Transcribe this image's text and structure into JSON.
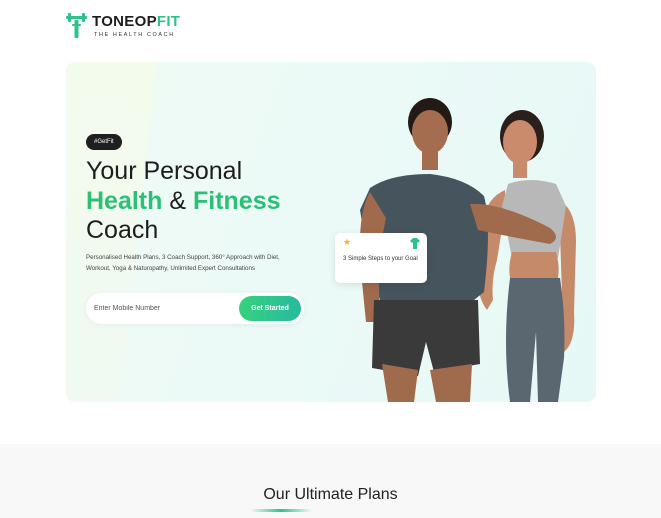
{
  "header": {
    "brand_main": "TONEOP",
    "brand_accent": "FIT",
    "tagline": "THE HEALTH COACH"
  },
  "hero": {
    "badge": "#GetFit",
    "headline_line1": "Your Personal",
    "headline_accent1": "Health",
    "headline_joiner": " & ",
    "headline_accent2": "Fitness",
    "headline_line3": "Coach",
    "description": "Personalised Health Plans, 3 Coach Support, 360° Approach with Diet, Workout, Yoga & Naturopathy, Unlimited Expert Consultations",
    "mobile_input": {
      "placeholder": "Enter Mobile Number",
      "value": ""
    },
    "cta_label": "Get Started",
    "steps_card_text": "3 Simple Steps to your Goal"
  },
  "plans": {
    "title": "Our Ultimate Plans"
  },
  "colors": {
    "brand_green": "#2ec28a",
    "accent_green": "#2cbf77",
    "badge_bg": "#1f1f1f",
    "star": "#f5b321"
  },
  "icons": {
    "logo": "t-dumbbell-logo-icon",
    "steps_star": "star-icon",
    "steps_tshirt": "tshirt-icon"
  }
}
